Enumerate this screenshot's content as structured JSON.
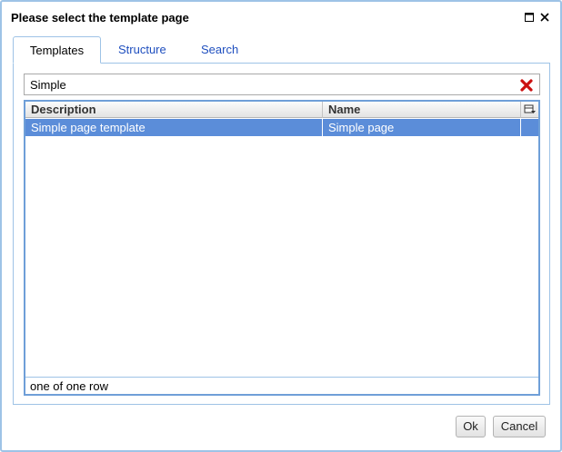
{
  "dialog": {
    "title": "Please select the template page",
    "controls": {
      "maximize_icon": "maximize-icon",
      "close_icon": "close-icon"
    }
  },
  "tabs": [
    {
      "label": "Templates",
      "active": true
    },
    {
      "label": "Structure",
      "active": false
    },
    {
      "label": "Search",
      "active": false
    }
  ],
  "filter": {
    "value": "Simple",
    "clear_icon": "clear-filter-icon"
  },
  "grid": {
    "columns": [
      "Description",
      "Name"
    ],
    "rows": [
      {
        "description": "Simple page template",
        "name": "Simple page",
        "selected": true
      }
    ],
    "status": "one of one row"
  },
  "buttons": {
    "ok": "Ok",
    "cancel": "Cancel"
  },
  "colors": {
    "selection": "#5b8dd9",
    "border": "#9ec3e6",
    "link": "#1f4fbf",
    "clear_icon": "#cc1111"
  }
}
